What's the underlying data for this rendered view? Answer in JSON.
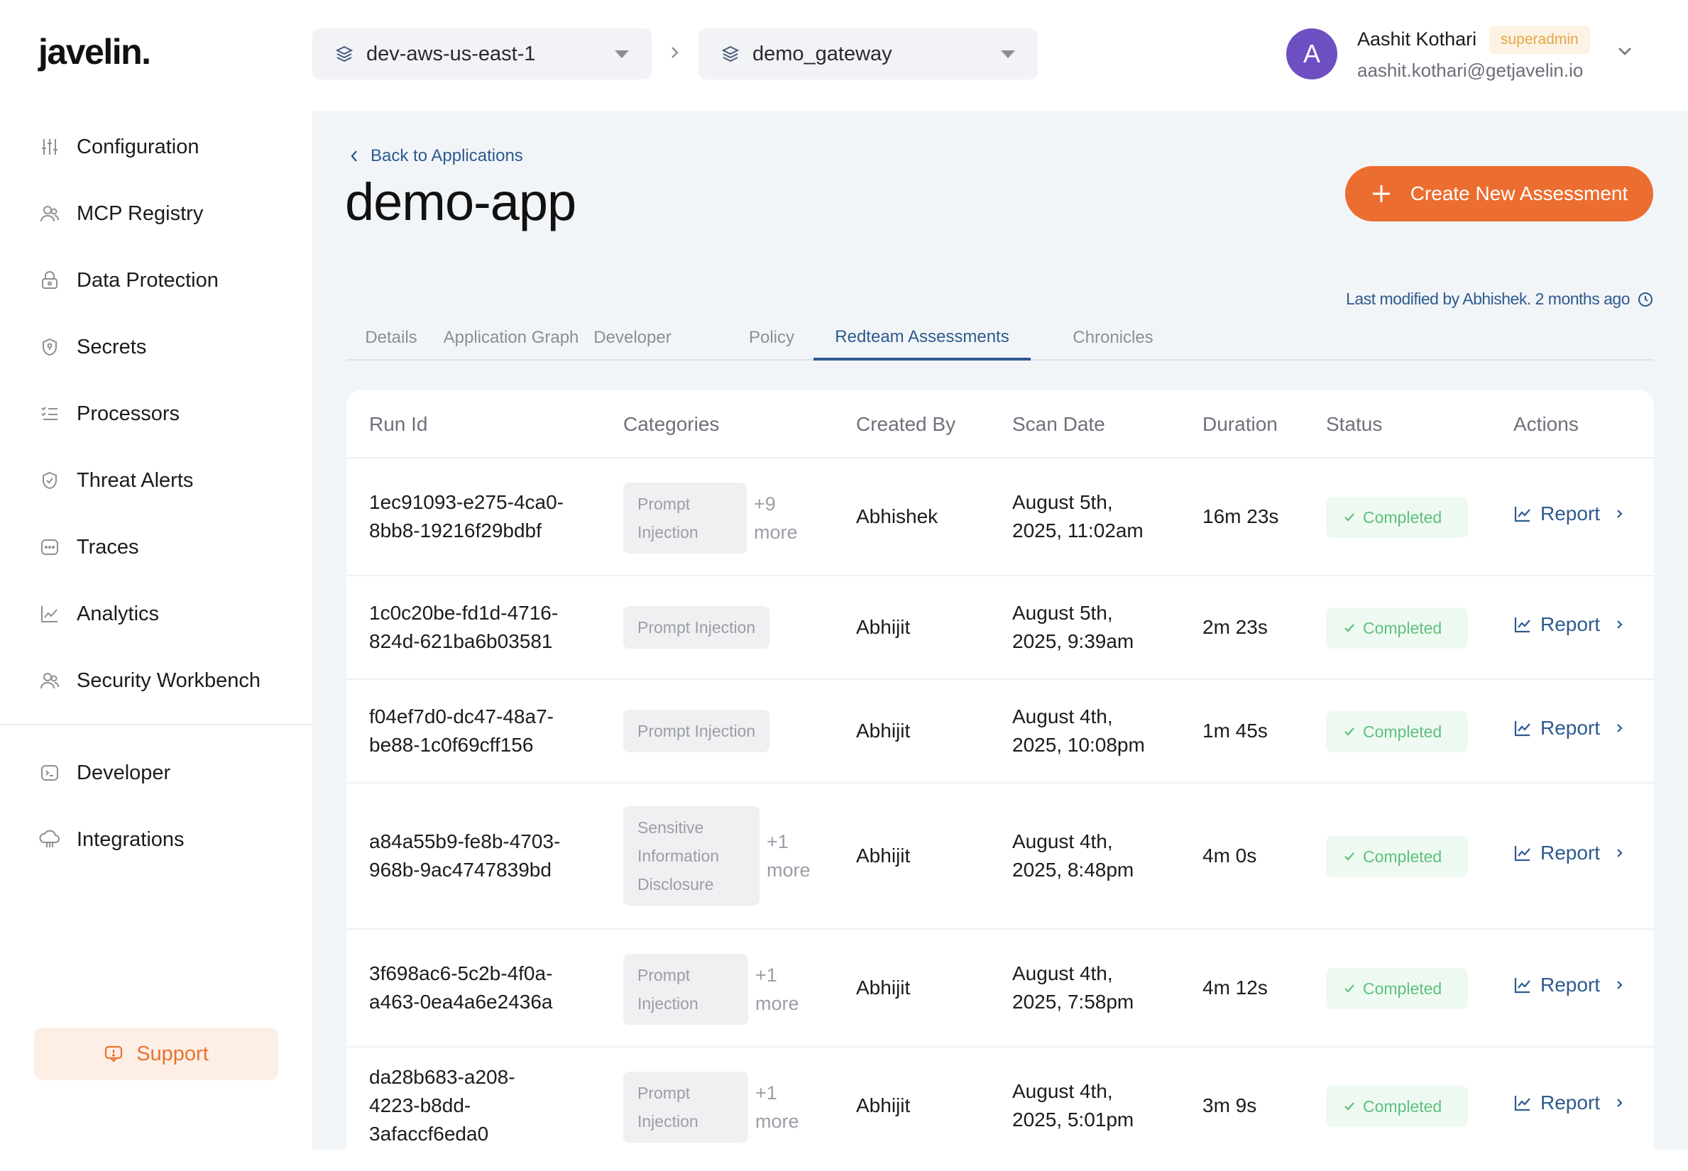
{
  "brand": {
    "logo": "javelin."
  },
  "sidebar": {
    "items": [
      {
        "label": "Configuration",
        "icon": "sliders-icon"
      },
      {
        "label": "MCP Registry",
        "icon": "users-icon"
      },
      {
        "label": "Data Protection",
        "icon": "lock-icon"
      },
      {
        "label": "Secrets",
        "icon": "shield-lock-icon"
      },
      {
        "label": "Processors",
        "icon": "list-check-icon"
      },
      {
        "label": "Threat Alerts",
        "icon": "shield-check-icon"
      },
      {
        "label": "Traces",
        "icon": "dots-box-icon"
      },
      {
        "label": "Analytics",
        "icon": "line-chart-icon"
      },
      {
        "label": "Security Workbench",
        "icon": "users-icon"
      }
    ],
    "secondary": [
      {
        "label": "Developer",
        "icon": "terminal-icon"
      },
      {
        "label": "Integrations",
        "icon": "cloud-icon"
      }
    ],
    "support": "Support"
  },
  "header": {
    "environment": "dev-aws-us-east-1",
    "gateway": "demo_gateway",
    "user": {
      "initial": "A",
      "name": "Aashit Kothari",
      "role": "superadmin",
      "email": "aashit.kothari@getjavelin.io"
    }
  },
  "main": {
    "back_label": "Back to Applications",
    "title": "demo-app",
    "create_button": "Create New Assessment",
    "last_modified": "Last modified by Abhishek. 2 months ago",
    "tabs": [
      "Details",
      "Application Graph",
      "Developer",
      "Policy",
      "Redteam Assessments",
      "Chronicles"
    ],
    "active_tab": "Redteam Assessments"
  },
  "table": {
    "columns": [
      "Run Id",
      "Categories",
      "Created By",
      "Scan Date",
      "Duration",
      "Status",
      "Actions"
    ],
    "rows": [
      {
        "run_id": "1ec91093-e275-4ca0-8bb8-19216f29bdbf",
        "category": "Prompt Injection",
        "more": "+9 more",
        "created_by": "Abhishek",
        "scan_date": "August 5th, 2025, 11:02am",
        "duration": "16m 23s",
        "status": "Completed",
        "action": "Report"
      },
      {
        "run_id": "1c0c20be-fd1d-4716-824d-621ba6b03581",
        "category": "Prompt Injection",
        "more": "",
        "created_by": "Abhijit",
        "scan_date": "August 5th, 2025, 9:39am",
        "duration": "2m 23s",
        "status": "Completed",
        "action": "Report"
      },
      {
        "run_id": "f04ef7d0-dc47-48a7-be88-1c0f69cff156",
        "category": "Prompt Injection",
        "more": "",
        "created_by": "Abhijit",
        "scan_date": "August 4th, 2025, 10:08pm",
        "duration": "1m 45s",
        "status": "Completed",
        "action": "Report"
      },
      {
        "run_id": "a84a55b9-fe8b-4703-968b-9ac4747839bd",
        "category": "Sensitive Information Disclosure",
        "more": "+1 more",
        "created_by": "Abhijit",
        "scan_date": "August 4th, 2025, 8:48pm",
        "duration": "4m 0s",
        "status": "Completed",
        "action": "Report"
      },
      {
        "run_id": "3f698ac6-5c2b-4f0a-a463-0ea4a6e2436a",
        "category": "Prompt Injection",
        "more": "+1 more",
        "created_by": "Abhijit",
        "scan_date": "August 4th, 2025, 7:58pm",
        "duration": "4m 12s",
        "status": "Completed",
        "action": "Report"
      },
      {
        "run_id": "da28b683-a208-4223-b8dd-3afaccf6eda0",
        "category": "Prompt Injection",
        "more": "+1 more",
        "created_by": "Abhijit",
        "scan_date": "August 4th, 2025, 5:01pm",
        "duration": "3m 9s",
        "status": "Completed",
        "action": "Report"
      }
    ]
  },
  "colors": {
    "accent": "#ec6d30",
    "link": "#2e5a8e",
    "success": "#5fbf7d",
    "avatar": "#6d4fc2"
  }
}
